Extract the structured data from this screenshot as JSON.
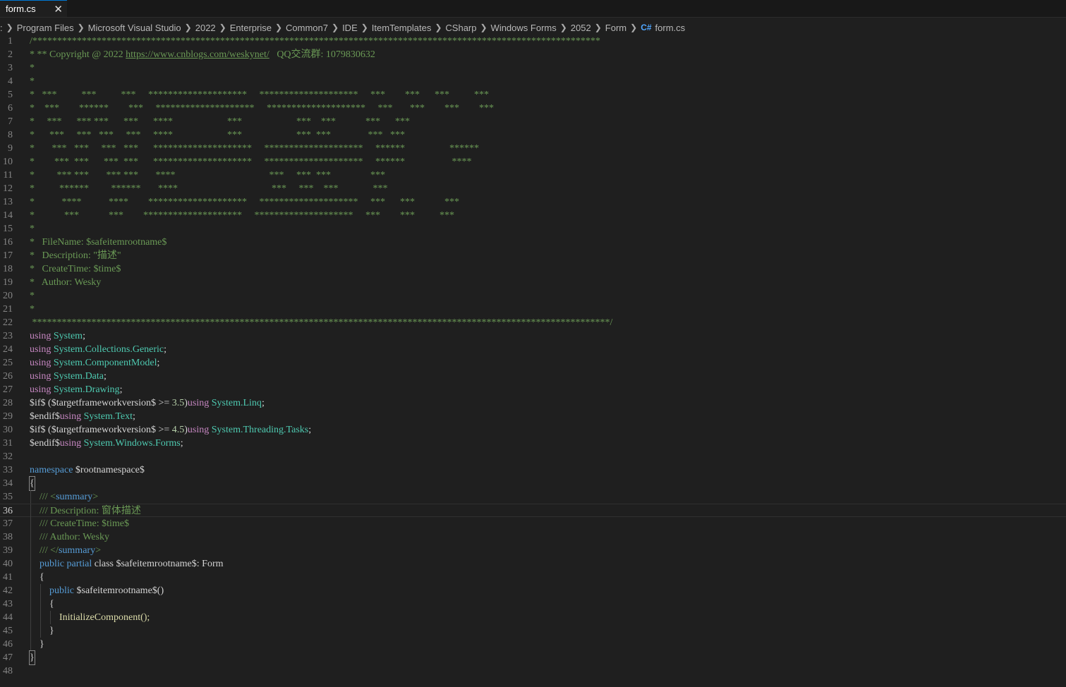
{
  "tab": {
    "label": "form.cs",
    "close": "✕"
  },
  "breadcrumb": [
    ":",
    "Program Files",
    "Microsoft Visual Studio",
    "2022",
    "Enterprise",
    "Common7",
    "IDE",
    "ItemTemplates",
    "CSharp",
    "Windows Forms",
    "2052",
    "Form",
    "form.cs"
  ],
  "header": [
    "/*******************************************************************************************************************",
    "* ** Copyright @ 2022 ",
    "https://www.cnblogs.com/weskynet/",
    "   QQ交流群: 1079830632",
    "*",
    "*",
    "*   ***          ***          ***     ********************     ********************     ***        ***      ***          ***",
    "*    ***        ******        ***     ********************     ********************     ***       ***        ***        ***",
    "*     ***      *** ***      ***      ****                      ***                      ***    ***            ***      ***",
    "*      ***     ***   ***     ***     ****                      ***                      ***  ***               ***   ***",
    "*       ***   ***     ***   ***      ********************     ********************     ******                  ******",
    "*        ***  ***      ***  ***      ********************     ********************     ******                   ****",
    "*         *** ***       *** ***       ****                                      ***     ***  ***                ***",
    "*          ******         ******       ****                                      ***     ***    ***              ***",
    "*           ****           ****        ********************     ********************     ***      ***            ***",
    "*            ***            ***        ********************     ********************     ***        ***          ***",
    "*",
    "*   FileName: $safeitemrootname$",
    "*   Description: \"描述\"",
    "*   CreateTime: $time$",
    "*   Author: Wesky",
    "*",
    "*",
    " *********************************************************************************************************************/"
  ],
  "using": [
    "System",
    "System.Collections.Generic",
    "System.ComponentModel",
    "System.Data",
    "System.Drawing"
  ],
  "cond": {
    "if1_pre": "$if$ ($targetframeworkversion$ >= ",
    "v1": "3.5",
    "if_post": ")",
    "linq": "System.Linq",
    "endif": "$endif$",
    "text": "System.Text",
    "v2": "4.5",
    "tasks": "System.Threading.Tasks",
    "forms": "System.Windows.Forms"
  },
  "kw": {
    "using": "using",
    "namespace": "namespace",
    "public": "public",
    "partial": "partial",
    "class": "class"
  },
  "body": {
    "nsname": " $rootnamespace$",
    "doc_open_pre": "/// <",
    "summary": "summary",
    "doc_open_post": ">",
    "doc_desc": "/// Description: 窗体描述",
    "doc_time": "/// CreateTime: $time$",
    "doc_author": "/// Author: Wesky",
    "doc_close_pre": "/// </",
    "classname": " $safeitemrootname$: Form",
    "ctor": " $safeitemrootname$()",
    "init": "InitializeComponent();",
    "semi": ";",
    "lbrace": "{",
    "rbrace": "}"
  },
  "line_numbers": [
    "1",
    "2",
    "3",
    "4",
    "5",
    "6",
    "7",
    "8",
    "9",
    "10",
    "11",
    "12",
    "13",
    "14",
    "15",
    "16",
    "17",
    "18",
    "19",
    "20",
    "21",
    "22",
    "23",
    "24",
    "25",
    "26",
    "27",
    "28",
    "29",
    "30",
    "31",
    "32",
    "33",
    "34",
    "35",
    "36",
    "37",
    "38",
    "39",
    "40",
    "41",
    "42",
    "43",
    "44",
    "45",
    "46",
    "47",
    "48"
  ],
  "icons": {
    "csharp": "C#"
  }
}
